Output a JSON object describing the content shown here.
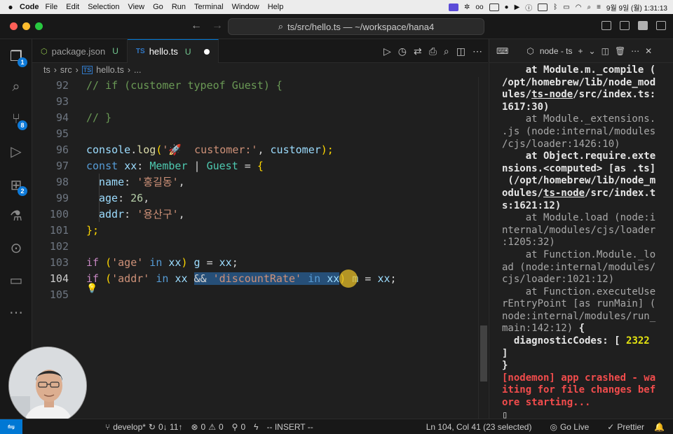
{
  "menubar": {
    "app": "Code",
    "items": [
      "File",
      "Edit",
      "Selection",
      "View",
      "Go",
      "Run",
      "Terminal",
      "Window",
      "Help"
    ],
    "clock": "9월 9일 (월) 1:31:13"
  },
  "titlebar": {
    "command_center": "ts/src/hello.ts — ~/workspace/hana4"
  },
  "activity": {
    "explorer_badge": "1",
    "scm_badge": "8",
    "extensions_badge": "2"
  },
  "tabs": [
    {
      "label": "package.json",
      "status": "U"
    },
    {
      "label": "hello.ts",
      "status": "U"
    }
  ],
  "breadcrumb": {
    "parts": [
      "ts",
      "src",
      "hello.ts",
      "..."
    ],
    "sep": "›"
  },
  "editor": {
    "lines": [
      {
        "n": "92"
      },
      {
        "n": "93"
      },
      {
        "n": "94"
      },
      {
        "n": "95"
      },
      {
        "n": "96"
      },
      {
        "n": "97"
      },
      {
        "n": "98"
      },
      {
        "n": "99"
      },
      {
        "n": "100"
      },
      {
        "n": "101"
      },
      {
        "n": "102"
      },
      {
        "n": "103"
      },
      {
        "n": "104"
      },
      {
        "n": "105"
      }
    ],
    "t92": "// if (customer typeof Guest) {",
    "t94": "// }",
    "t96_console": "console",
    "t96_dot": ".",
    "t96_log": "log",
    "t96_open": "(",
    "t96_str": "'🚀  customer:'",
    "t96_comma": ", ",
    "t96_var": "customer",
    "t96_close": ");",
    "t97_const": "const",
    "t97_xx": "xx",
    "t97_colon": ": ",
    "t97_member": "Member",
    "t97_bar": " | ",
    "t97_guest": "Guest",
    "t97_eq": " = ",
    "t97_brace": "{",
    "t98_key": "name",
    "t98_colon": ": ",
    "t98_val": "'홍길동'",
    "t98_comma": ",",
    "t99_key": "age",
    "t99_colon": ": ",
    "t99_val": "26",
    "t99_comma": ",",
    "t100_key": "addr",
    "t100_colon": ": ",
    "t100_val": "'용산구'",
    "t100_comma": ",",
    "t101": "};",
    "t103_if": "if",
    "t103_open": " (",
    "t103_str": "'age'",
    "t103_in": " in ",
    "t103_xx": "xx",
    "t103_close": ") ",
    "t103_g": "g",
    "t103_eq": " = ",
    "t103_xx2": "xx",
    "t103_semi": ";",
    "t104_if": "if",
    "t104_open": " (",
    "t104_str": "'addr'",
    "t104_in": " in ",
    "t104_xx": "xx",
    "t104_sp": " ",
    "t104_and": "&&",
    "t104_sp2": " ",
    "t104_str2": "'discountRate'",
    "t104_in2": " in ",
    "t104_xx2": "xx",
    "t104_close": ")",
    "t104_m": " m",
    "t104_eq": " = ",
    "t104_xx3": "xx",
    "t104_semi": ";"
  },
  "panel": {
    "terminal_name": "node - ts"
  },
  "terminal": {
    "l1": "    at Module.m._compile (",
    "l2a": "/opt/homebrew/lib/node_mod",
    "l3a": "ules/",
    "l3b": "ts-node",
    "l3c": "/src/index.ts:",
    "l4": "1617:30)",
    "l5": "    at Module._extensions.",
    "l6": ".js (node:internal/modules",
    "l7": "/cjs/loader:1426:10)",
    "l8": "    at Object.require.exte",
    "l9": "nsions.<computed> [as .ts]",
    "l10": " (/opt/homebrew/lib/node_m",
    "l11a": "odules/",
    "l11b": "ts-node",
    "l11c": "/src/index.t",
    "l12": "s:1621:12)",
    "l13": "    at Module.load (node:i",
    "l14": "nternal/modules/cjs/loader",
    "l15": ":1205:32)",
    "l16": "    at Function.Module._lo",
    "l17": "ad (node:internal/modules/",
    "l18": "cjs/loader:1021:12)",
    "l19": "    at Function.executeUse",
    "l20": "rEntryPoint [as runMain] (",
    "l21": "node:internal/modules/run_",
    "l22a": "main:142:12) ",
    "l22b": "{",
    "l23a": "  diagnosticCodes: [ ",
    "l23b": "2322",
    "l24": "]",
    "l25": "}",
    "l26": "[nodemon] app crashed - wa",
    "l27": "iting for file changes bef",
    "l28": "ore starting...",
    "l29": "▯"
  },
  "statusbar": {
    "branch": "develop*",
    "sync": "0↓ 11↑",
    "errors": "0",
    "warnings": "0",
    "ports": "0",
    "mode": "-- INSERT --",
    "position": "Ln 104, Col 41 (23 selected)",
    "golive": "Go Live",
    "prettier": "Prettier"
  },
  "colors": {
    "accent": "#0078d4",
    "editor_bg": "#1f1f1f",
    "selection": "#264f78",
    "error_text": "#f14c4c"
  }
}
